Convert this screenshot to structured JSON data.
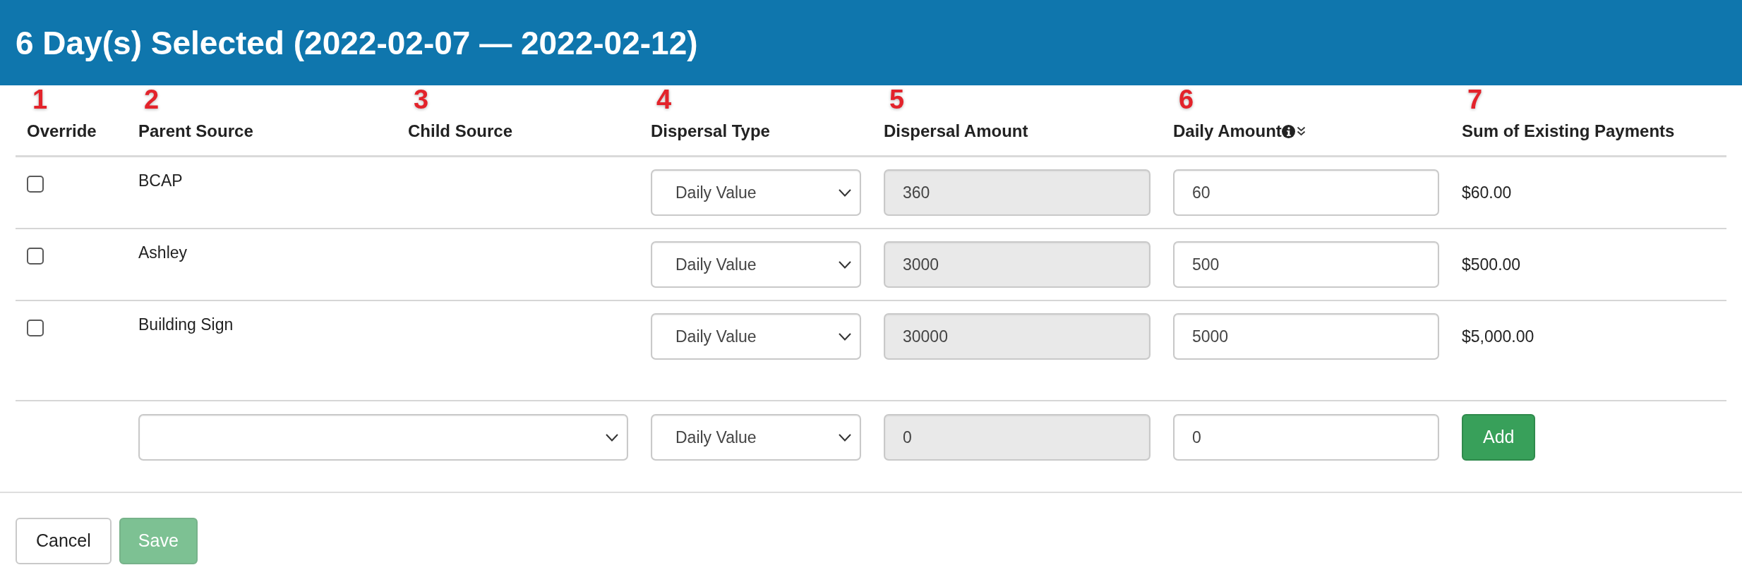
{
  "dialog": {
    "title": "6 Day(s) Selected (2022-02-07 — 2022-02-12)"
  },
  "table": {
    "columns": [
      {
        "marker": "1",
        "label": "Override",
        "kind": "plain"
      },
      {
        "marker": "2",
        "label": "Parent Source",
        "kind": "plain"
      },
      {
        "marker": "3",
        "label": "Child Source",
        "kind": "plain"
      },
      {
        "marker": "4",
        "label": "Dispersal Type",
        "kind": "plain"
      },
      {
        "marker": "5",
        "label": "Dispersal Amount",
        "kind": "plain"
      },
      {
        "marker": "6",
        "label": "Daily Amount",
        "kind": "info_toggle"
      },
      {
        "marker": "7",
        "label": "Sum of Existing Payments",
        "kind": "plain"
      }
    ],
    "rows": [
      {
        "override": {
          "checked": false
        },
        "parent_source": "BCAP",
        "dispersal_type": "Daily Value",
        "dispersal_amount": {
          "value": "360",
          "disabled": true
        },
        "daily_amount": {
          "value": "60",
          "disabled": false
        },
        "sum_of_existing_payments": "$60.00"
      },
      {
        "override": {
          "checked": false
        },
        "parent_source": "Ashley",
        "dispersal_type": "Daily Value",
        "dispersal_amount": {
          "value": "3000",
          "disabled": true
        },
        "daily_amount": {
          "value": "500",
          "disabled": false
        },
        "sum_of_existing_payments": "$500.00"
      },
      {
        "override": {
          "checked": false
        },
        "parent_source": "Building Sign",
        "dispersal_type": "Daily Value",
        "dispersal_amount": {
          "value": "30000",
          "disabled": true
        },
        "daily_amount": {
          "value": "5000",
          "disabled": false
        },
        "sum_of_existing_payments": "$5,000.00"
      }
    ],
    "new_row": {
      "dispersal_type": "Daily Value",
      "dispersal_amount": {
        "value": "0",
        "disabled": true
      },
      "daily_amount": {
        "value": "0",
        "disabled": false
      },
      "add_button": "Add"
    }
  },
  "footer": {
    "buttons": [
      {
        "label": "Cancel",
        "kind": "secondary",
        "disabled": false
      },
      {
        "label": "Save",
        "kind": "primary",
        "disabled": true
      }
    ]
  }
}
